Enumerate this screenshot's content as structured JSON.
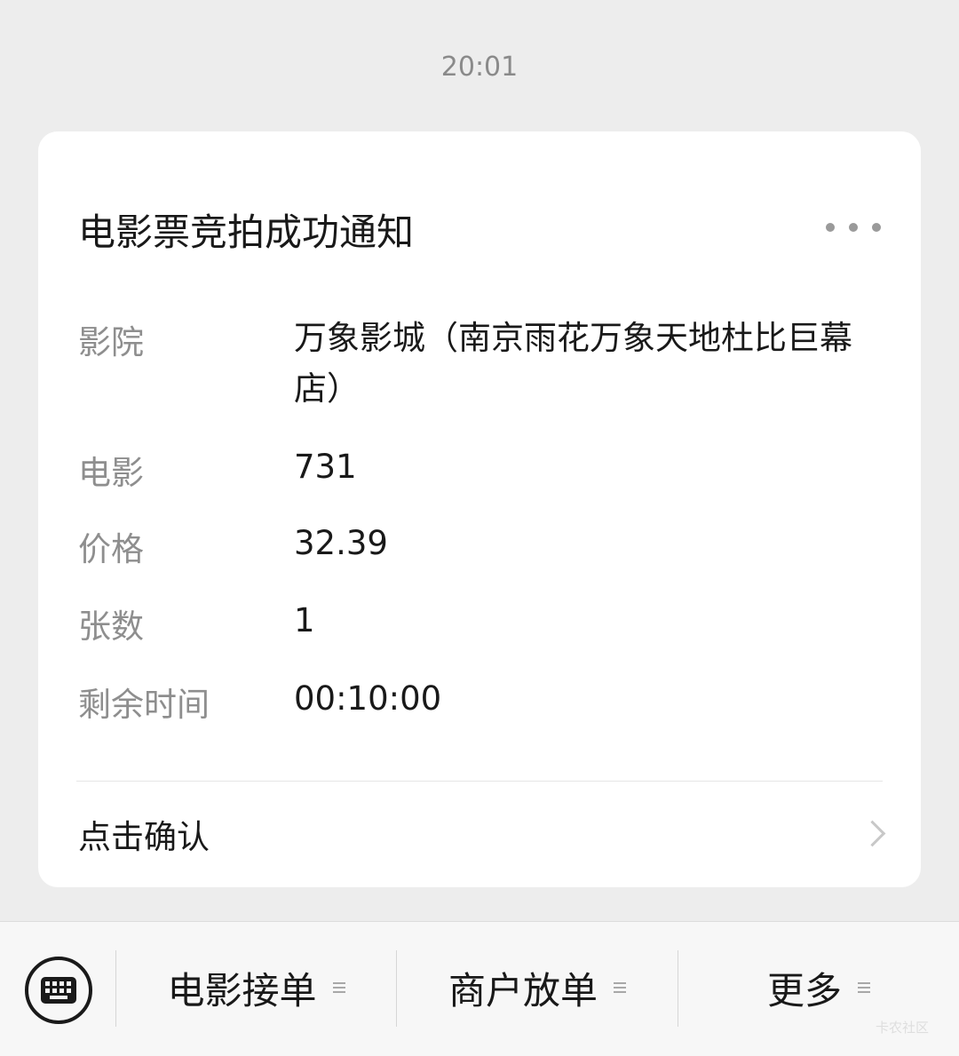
{
  "timestamp": "20:01",
  "card": {
    "title": "电影票竞拍成功通知",
    "rows": [
      {
        "label": "影院",
        "value": "万象影城（南京雨花万象天地杜比巨幕店）"
      },
      {
        "label": "电影",
        "value": "731"
      },
      {
        "label": "价格",
        "value": "32.39"
      },
      {
        "label": "张数",
        "value": "1"
      },
      {
        "label": "剩余时间",
        "value": "00:10:00"
      }
    ],
    "confirm_label": "点击确认"
  },
  "menu": {
    "items": [
      {
        "label": "电影接单",
        "icon": "menu-lines-icon"
      },
      {
        "label": "商户放单",
        "icon": "menu-lines-icon"
      },
      {
        "label": "更多",
        "icon": "menu-lines-icon"
      }
    ]
  },
  "watermark": "卡农社区",
  "icons": {
    "keyboard": "keyboard-icon",
    "more": "more-dots-icon",
    "chevron": "chevron-right-icon"
  }
}
